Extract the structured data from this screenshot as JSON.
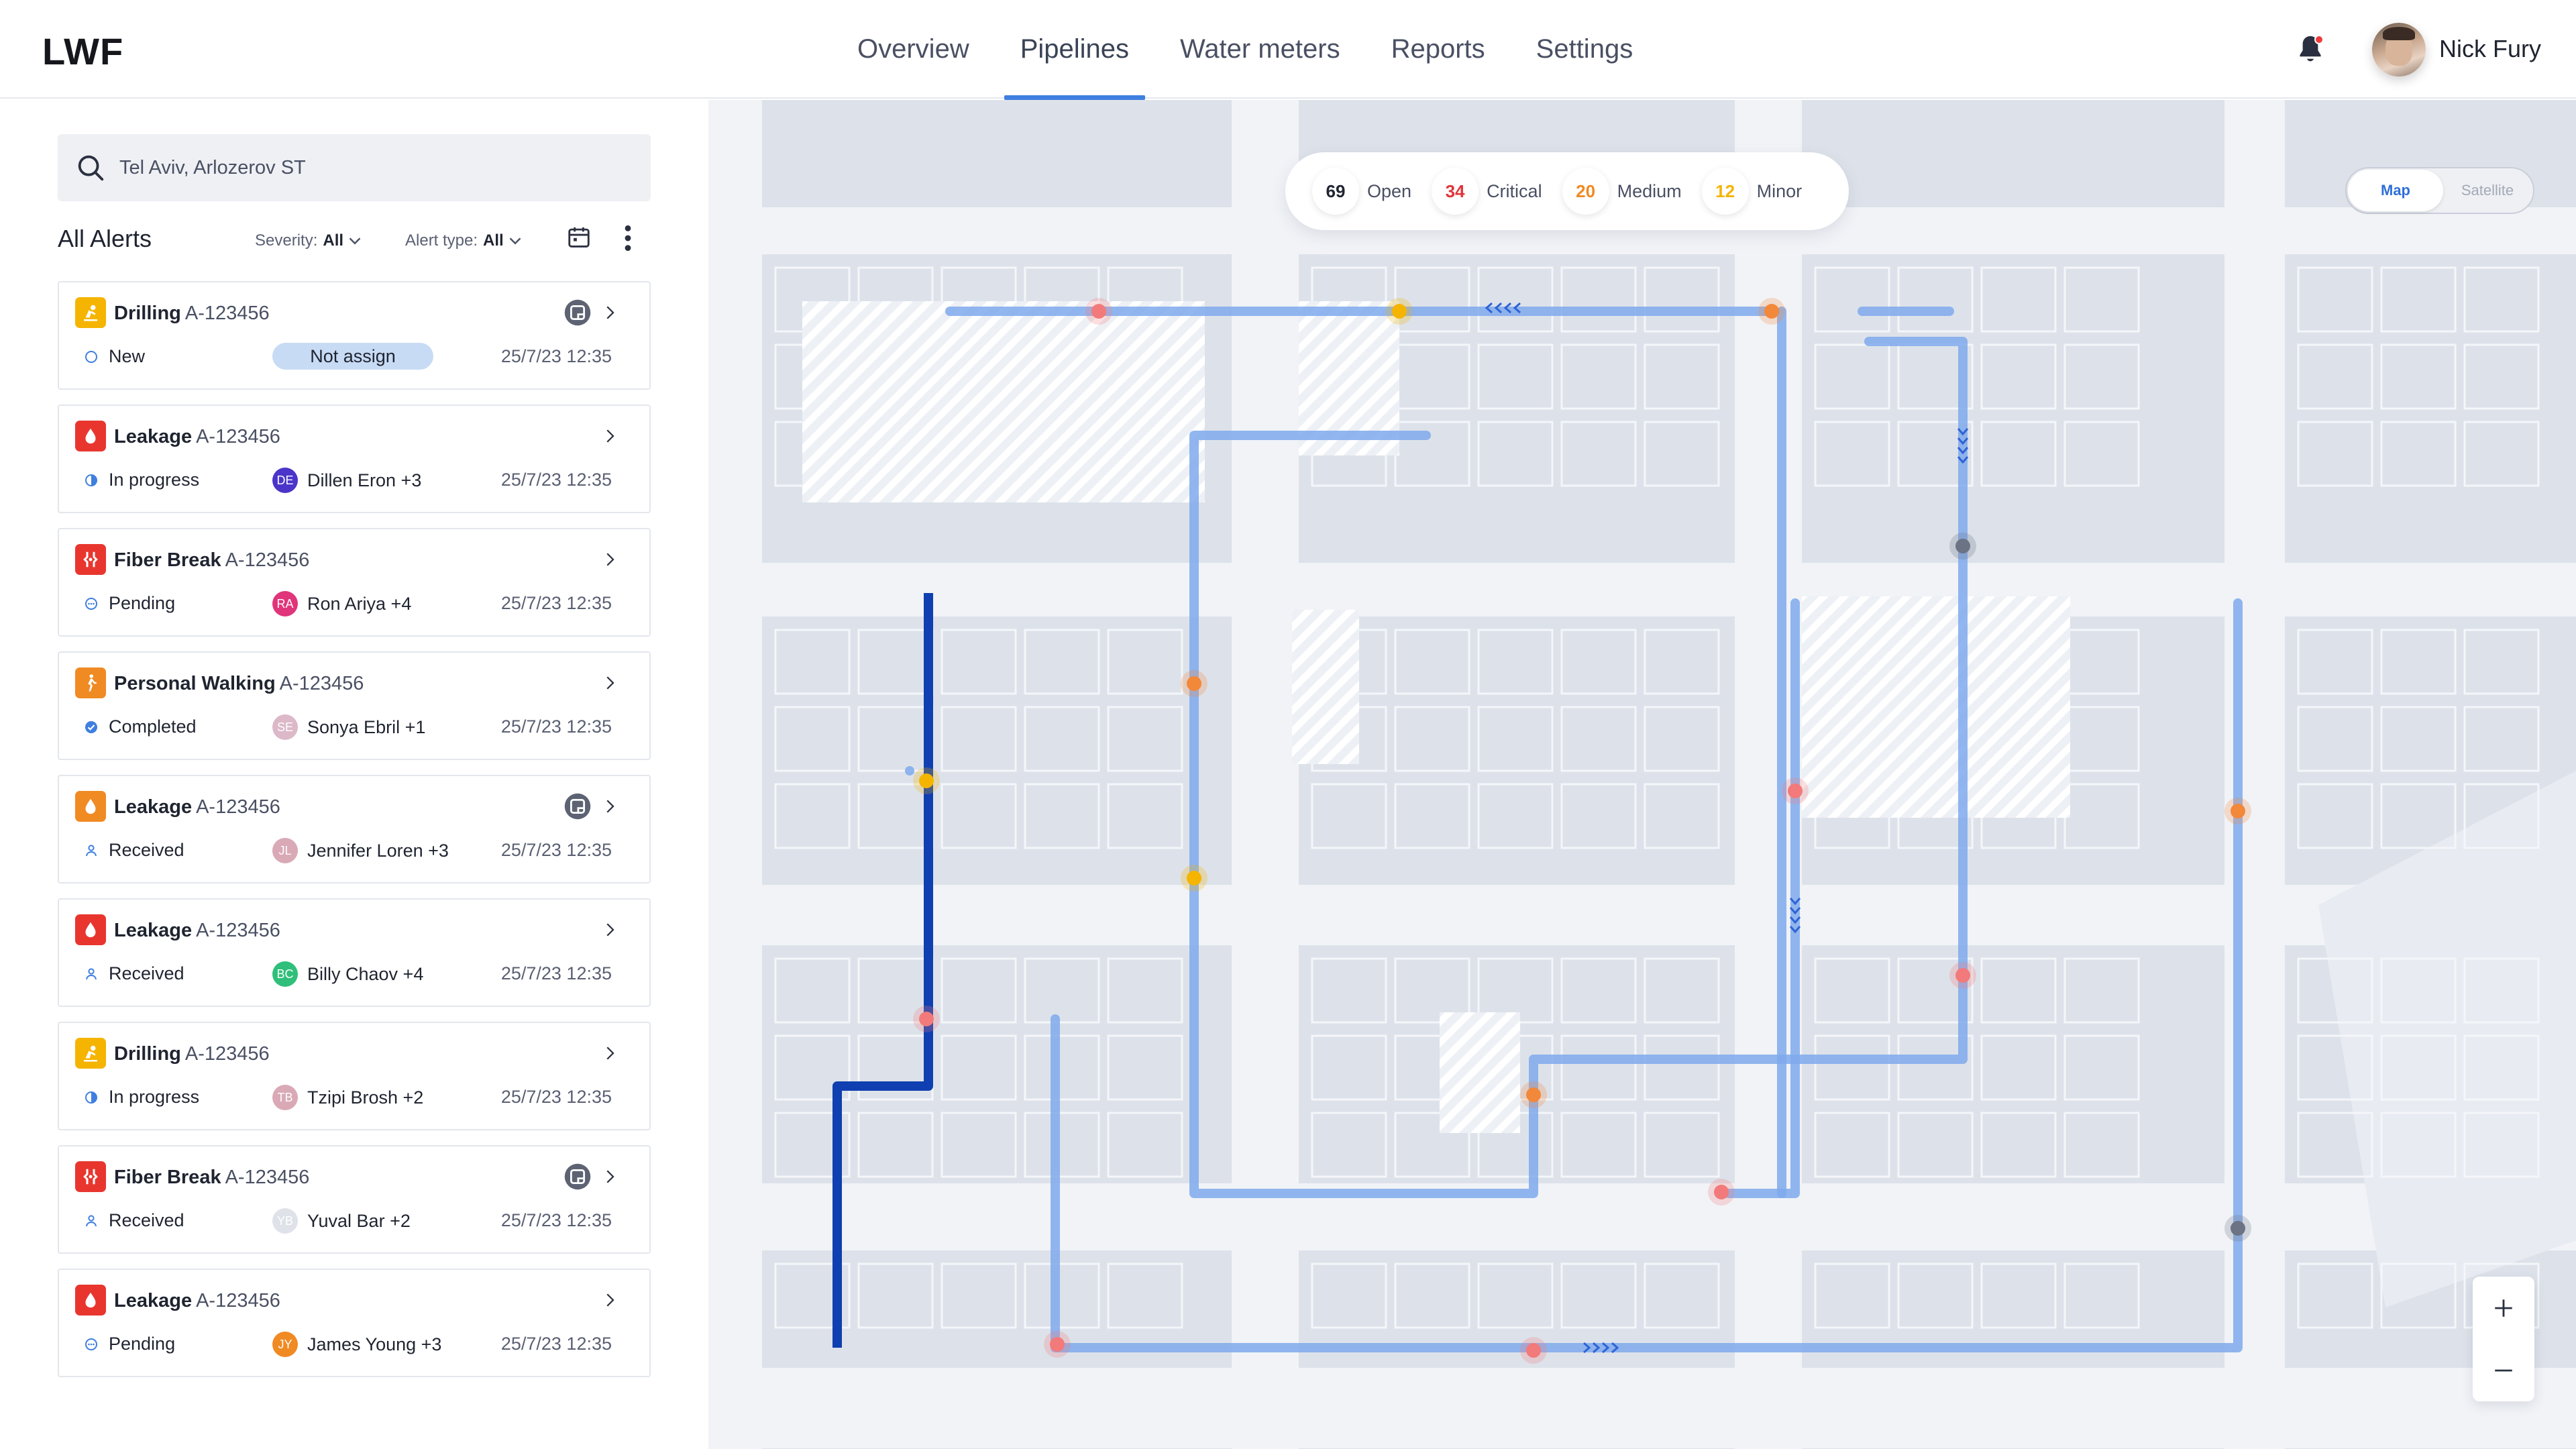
{
  "app": {
    "logo": "LWF"
  },
  "nav": {
    "items": [
      {
        "label": "Overview",
        "active": false
      },
      {
        "label": "Pipelines",
        "active": true
      },
      {
        "label": "Water meters",
        "active": false
      },
      {
        "label": "Reports",
        "active": false
      },
      {
        "label": "Settings",
        "active": false
      }
    ]
  },
  "user": {
    "name": "Nick Fury",
    "has_notification": true
  },
  "search": {
    "value": "Tel Aviv, Arlozerov ST"
  },
  "alerts_panel": {
    "title": "All Alerts",
    "severity_label": "Severity:",
    "severity_value": "All",
    "alert_type_label": "Alert type:",
    "alert_type_value": "All"
  },
  "alerts": [
    {
      "type": "Drilling",
      "id": "A-123456",
      "status": "New",
      "assignee": "Not assign",
      "initials": "",
      "time": "25/7/23 12:35",
      "has_note": true,
      "icon": "drilling-icon",
      "color": "#f5b400",
      "status_icon": "new",
      "avatar_color": ""
    },
    {
      "type": "Leakage",
      "id": "A-123456",
      "status": "In progress",
      "assignee": "Dillen Eron +3",
      "initials": "DE",
      "time": "25/7/23 12:35",
      "has_note": false,
      "icon": "water-drop-icon",
      "color": "#e8362f",
      "status_icon": "progress",
      "avatar_color": "#4b35c9"
    },
    {
      "type": "Fiber Break",
      "id": "A-123456",
      "status": "Pending",
      "assignee": "Ron Ariya +4",
      "initials": "RA",
      "time": "25/7/23 12:35",
      "has_note": false,
      "icon": "fiber-break-icon",
      "color": "#e8362f",
      "status_icon": "pending",
      "avatar_color": "#e0357a"
    },
    {
      "type": "Personal Walking",
      "id": "A-123456",
      "status": "Completed",
      "assignee": "Sonya Ebril +1",
      "initials": "SE",
      "time": "25/7/23 12:35",
      "has_note": false,
      "icon": "walking-icon",
      "color": "#f08a23",
      "status_icon": "completed",
      "avatar_color": "#dcb8c8"
    },
    {
      "type": "Leakage",
      "id": "A-123456",
      "status": "Received",
      "assignee": "Jennifer Loren +3",
      "initials": "JL",
      "time": "25/7/23 12:35",
      "has_note": true,
      "icon": "water-drop-icon",
      "color": "#f08a23",
      "status_icon": "received",
      "avatar_color": "#d9a9b6"
    },
    {
      "type": "Leakage",
      "id": "A-123456",
      "status": "Received",
      "assignee": "Billy Chaov +4",
      "initials": "BC",
      "time": "25/7/23 12:35",
      "has_note": false,
      "icon": "water-drop-icon",
      "color": "#e8362f",
      "status_icon": "received",
      "avatar_color": "#2fbf7a"
    },
    {
      "type": "Drilling",
      "id": "A-123456",
      "status": "In progress",
      "assignee": "Tzipi Brosh +2",
      "initials": "TB",
      "time": "25/7/23 12:35",
      "has_note": false,
      "icon": "drilling-icon",
      "color": "#f5b400",
      "status_icon": "progress",
      "avatar_color": "#d9a9b6"
    },
    {
      "type": "Fiber Break",
      "id": "A-123456",
      "status": "Received",
      "assignee": "Yuval Bar +2",
      "initials": "YB",
      "time": "25/7/23 12:35",
      "has_note": true,
      "icon": "fiber-break-icon",
      "color": "#e8362f",
      "status_icon": "received",
      "avatar_color": "#dfe2e8"
    },
    {
      "type": "Leakage",
      "id": "A-123456",
      "status": "Pending",
      "assignee": "James Young +3",
      "initials": "JY",
      "time": "25/7/23 12:35",
      "has_note": false,
      "icon": "water-drop-icon",
      "color": "#e8362f",
      "status_icon": "pending",
      "avatar_color": "#f08a23"
    }
  ],
  "map_stats": [
    {
      "count": "69",
      "label": "Open",
      "color": "#4a5063"
    },
    {
      "count": "34",
      "label": "Critical",
      "color": "#e0353a"
    },
    {
      "count": "20",
      "label": "Medium",
      "color": "#f08a23"
    },
    {
      "count": "12",
      "label": "Minor",
      "color": "#f5b400"
    }
  ],
  "map_toggle": {
    "map_label": "Map",
    "satellite_label": "Satellite",
    "selected": "Map"
  },
  "colors": {
    "accent": "#3f7fe0",
    "pipeline": "#7fa9ec",
    "pipeline_selected": "#0f3fb0",
    "critical": "#f27a7a",
    "medium": "#f2883a",
    "minor": "#f5b400",
    "sensor": "#6b7384"
  }
}
